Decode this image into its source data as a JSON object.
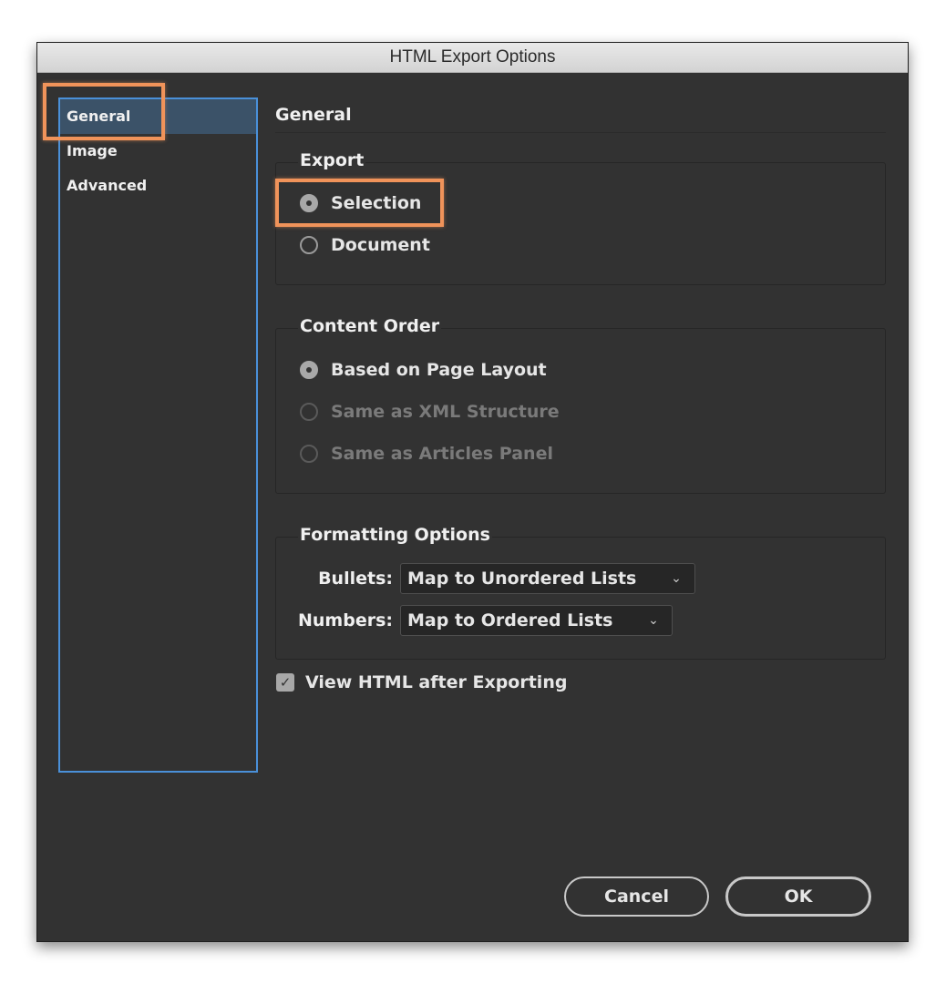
{
  "window": {
    "title": "HTML Export Options"
  },
  "sidebar": {
    "items": [
      {
        "label": "General",
        "active": true
      },
      {
        "label": "Image",
        "active": false
      },
      {
        "label": "Advanced",
        "active": false
      }
    ]
  },
  "main": {
    "section_title": "General",
    "export_group": {
      "title": "Export",
      "options": [
        {
          "label": "Selection",
          "checked": true,
          "disabled": false
        },
        {
          "label": "Document",
          "checked": false,
          "disabled": false
        }
      ]
    },
    "content_order_group": {
      "title": "Content Order",
      "options": [
        {
          "label": "Based on Page Layout",
          "checked": true,
          "disabled": false
        },
        {
          "label": "Same as XML Structure",
          "checked": false,
          "disabled": true
        },
        {
          "label": "Same as Articles Panel",
          "checked": false,
          "disabled": true
        }
      ]
    },
    "formatting_group": {
      "title": "Formatting Options",
      "bullets_label": "Bullets:",
      "bullets_value": "Map to Unordered Lists",
      "numbers_label": "Numbers:",
      "numbers_value": "Map to Ordered Lists"
    },
    "view_after_export": {
      "label": "View HTML after Exporting",
      "checked": true
    }
  },
  "buttons": {
    "cancel": "Cancel",
    "ok": "OK"
  },
  "colors": {
    "highlight": "#f0935a",
    "sidebar_border": "#4a90d9",
    "dialog_bg": "#323232"
  }
}
